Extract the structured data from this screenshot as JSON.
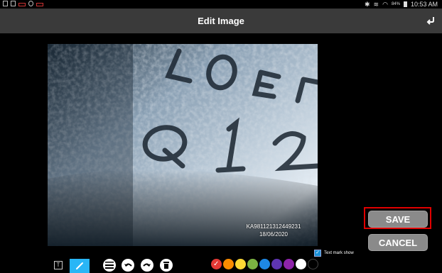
{
  "status_bar": {
    "time": "10:53 AM",
    "battery": "84%"
  },
  "header": {
    "title": "Edit Image"
  },
  "image": {
    "watermark_id": "KA981121312449231",
    "watermark_date": "18/06/2020"
  },
  "actions": {
    "save_label": "SAVE",
    "cancel_label": "CANCEL"
  },
  "text_mark": {
    "label": "Text mark show",
    "checked": true
  },
  "toolbar": {
    "text_tool_glyph": "T",
    "icons": [
      "text-tool-icon",
      "brush-icon",
      "line-width-icon",
      "undo-icon",
      "redo-icon",
      "delete-icon"
    ],
    "colors": [
      "#e53935",
      "#fb8c00",
      "#fdd835",
      "#7cb342",
      "#1e88e5",
      "#5e35b1",
      "#8e24aa",
      "#ffffff",
      "#000000"
    ],
    "selected_color_index": 0
  }
}
